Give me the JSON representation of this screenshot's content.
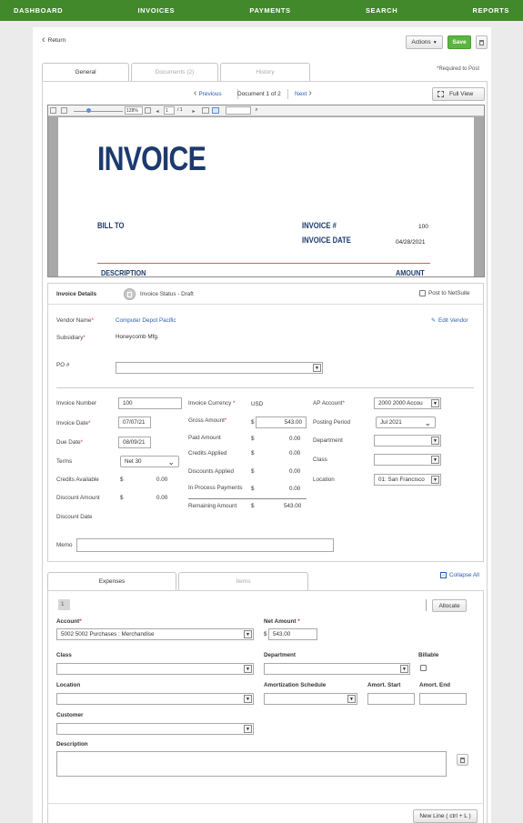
{
  "nav": {
    "items": [
      "DASHBOARD",
      "INVOICES",
      "PAYMENTS",
      "SEARCH",
      "REPORTS"
    ]
  },
  "toolbar": {
    "return_label": "Return",
    "actions_label": "Actions",
    "save_label": "Save"
  },
  "tabs": {
    "general": "General",
    "documents": "Documents (2)",
    "history": "History",
    "required_note": "Required to Post"
  },
  "doc_nav": {
    "previous": "Previous",
    "counter": "Document 1 of 2",
    "next": "Next",
    "full_view": "Full View"
  },
  "viewer": {
    "zoom": "128%",
    "page_current": "1",
    "page_total": "/ 1",
    "search_value": ""
  },
  "invoice_doc": {
    "title": "INVOICE",
    "bill_to": "BILL TO",
    "invoice_no_label": "INVOICE #",
    "invoice_no": "100",
    "invoice_date_label": "INVOICE DATE",
    "invoice_date": "04/28/2021",
    "description_header": "DESCRIPTION",
    "amount_header": "AMOUNT"
  },
  "details": {
    "header": "Invoice Details",
    "status": "Invoice Status - Draft",
    "post_to_netsuite": "Post to NetSuite",
    "vendor_name_label": "Vendor Name",
    "vendor_name": "Computer Depot Pacific",
    "edit_vendor": "Edit Vendor",
    "subsidiary_label": "Subsidiary",
    "subsidiary": "Honeycomb Mfg.",
    "po_label": "PO #",
    "po_value": "",
    "invoice_number_label": "Invoice Number",
    "invoice_number": "100",
    "invoice_date_label": "Invoice Date",
    "invoice_date": "07/07/21",
    "due_date_label": "Due Date",
    "due_date": "08/09/21",
    "terms_label": "Terms",
    "terms": "Net 30",
    "credits_available_label": "Credits Available",
    "credits_available": "0.00",
    "discount_amount_label": "Discount Amount",
    "discount_amount": "0.00",
    "discount_date_label": "Discount Date",
    "currency_label": "Invoice Currency",
    "currency": "USD",
    "gross_amount_label": "Gross Amount",
    "gross_amount": "543.00",
    "paid_amount_label": "Paid Amount",
    "paid_amount": "0.00",
    "credits_applied_label": "Credits Applied",
    "credits_applied": "0.00",
    "discounts_applied_label": "Discounts Applied",
    "discounts_applied": "0.00",
    "in_process_label": "In Process Payments",
    "in_process": "0.00",
    "remaining_label": "Remaining Amount",
    "remaining": "543.00",
    "dollar": "$",
    "ap_account_label": "AP Account",
    "ap_account": "2000 2000 Accou",
    "posting_period_label": "Posting Period",
    "posting_period": "Jul 2021",
    "department_label": "Department",
    "department": "",
    "class_label": "Class",
    "class": "",
    "location_label": "Location",
    "location": "01: San Francisco",
    "memo_label": "Memo",
    "memo": ""
  },
  "lines": {
    "tab_expenses": "Expenses",
    "tab_items": "Items",
    "collapse_all": "Collapse All",
    "row_number": "1",
    "allocate": "Allocate",
    "account_label": "Account",
    "account": "5002 5002 Purchases : Merchandise",
    "net_amount_label": "Net Amount",
    "net_amount": "543.00",
    "class_label": "Class",
    "department_label": "Department",
    "billable_label": "Billable",
    "location_label": "Location",
    "amort_schedule_label": "Amortization Schedule",
    "amort_start_label": "Amort. Start",
    "amort_end_label": "Amort. End",
    "customer_label": "Customer",
    "description_label": "Description",
    "new_line": "New Line ( ctrl + L )"
  },
  "colors": {
    "nav_green": "#42892c",
    "save_green": "#5cb541",
    "link_blue": "#2a5db0",
    "invoice_navy": "#1c3a6e",
    "required_red": "#d33"
  }
}
